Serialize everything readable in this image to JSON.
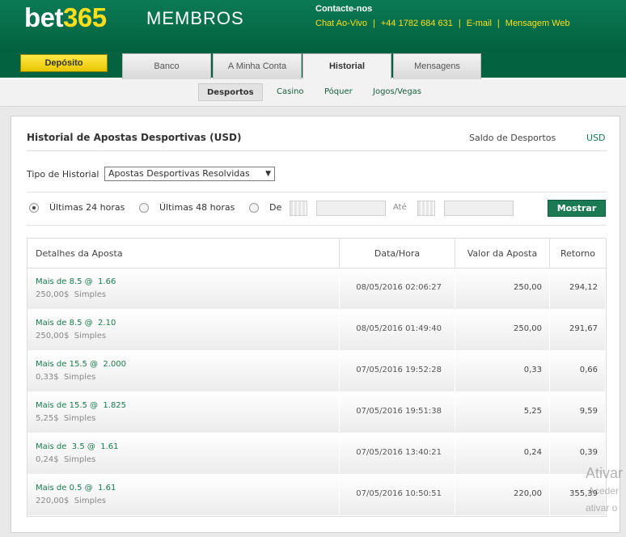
{
  "header": {
    "logo_text": "bet",
    "logo_highlight": "365",
    "title": "MEMBROS",
    "contact_title": "Contacte-nos",
    "contact_links": [
      "Chat Ao-Vivo",
      "+44 1782 684 631",
      "E-mail",
      "Mensagem Web"
    ],
    "separator": "|"
  },
  "tabs": {
    "deposit_label": "Depósito",
    "items": [
      "Banco",
      "A Minha Conta",
      "Historial",
      "Mensagens"
    ],
    "active": "Historial"
  },
  "subnav": {
    "items": [
      "Desportos",
      "Casino",
      "Póquer",
      "Jogos/Vegas"
    ],
    "active": "Desportos"
  },
  "panel": {
    "title": "Historial de Apostas Desportivas (USD)",
    "saldo_label": "Saldo de Desportos",
    "saldo_currency": "USD",
    "tipo_label": "Tipo de Historial",
    "tipo_value": "Apostas Desportivas Resolvidas",
    "tipo_arrow": "▼",
    "radio_options": [
      "Últimas 24 horas",
      "Últimas 48 horas",
      "De"
    ],
    "radio_selected": "Últimas 24 horas",
    "ate_label": "Até",
    "mostrar_label": "Mostrar"
  },
  "table": {
    "headers": [
      "Detalhes da Aposta",
      "Data/Hora",
      "Valor da Aposta",
      "Retorno"
    ],
    "rows": [
      {
        "bet": "Mais de 8.5 @  1.66",
        "sub": "250,00$  Simples",
        "datetime": "08/05/2016 02:06:27",
        "stake": "250,00",
        "return": "294,12"
      },
      {
        "bet": "Mais de 8.5 @  2.10",
        "sub": "250,00$  Simples",
        "datetime": "08/05/2016 01:49:40",
        "stake": "250,00",
        "return": "291,67"
      },
      {
        "bet": "Mais de 15.5 @  2.000",
        "sub": "0,33$  Simples",
        "datetime": "07/05/2016 19:52:28",
        "stake": "0,33",
        "return": "0,66"
      },
      {
        "bet": "Mais de 15.5 @  1.825",
        "sub": "5,25$  Simples",
        "datetime": "07/05/2016 19:51:38",
        "stake": "5,25",
        "return": "9,59"
      },
      {
        "bet": "Mais de  3.5 @  1.61",
        "sub": "0,24$  Simples",
        "datetime": "07/05/2016 13:40:21",
        "stake": "0,24",
        "return": "0,39"
      },
      {
        "bet": "Mais de 0.5 @  1.61",
        "sub": "220,00$  Simples",
        "datetime": "07/05/2016 10:50:51",
        "stake": "220,00",
        "return": "355,39"
      }
    ]
  },
  "watermark": {
    "line1": "Ativar",
    "line2": "Aceder",
    "line3": "ativar o"
  }
}
